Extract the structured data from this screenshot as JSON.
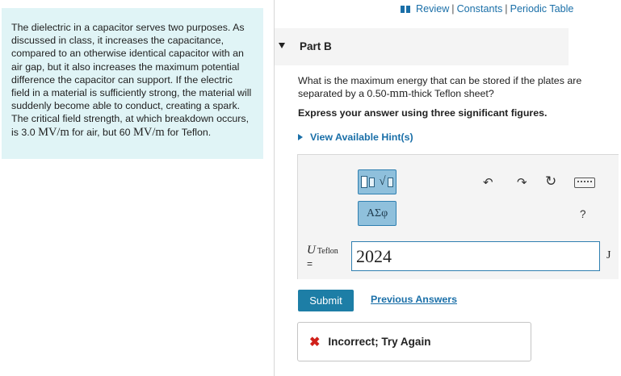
{
  "topbar": {
    "review": "Review",
    "constants": "Constants",
    "periodic": "Periodic Table",
    "sep": "|"
  },
  "intro": {
    "text_before": "The dielectric in a capacitor serves two purposes. As discussed in class, it increases the capacitance, compared to an otherwise identical capacitor with an air gap, but it also  increases the maximum potential difference the capacitor can support. If the electric field in a material is sufficiently strong, the material will suddenly become able to conduct, creating a spark. The critical field strength, at which breakdown occurs, is 3.0 ",
    "unit1": "MV/m",
    "text_mid": " for air, but 60 ",
    "unit2": "MV/m",
    "text_after": " for Teflon."
  },
  "part": {
    "title": "Part B"
  },
  "question": {
    "before": "What is the maximum energy that can be stored if the plates are separated by a 0.50-",
    "unit": "mm",
    "after": "-thick Teflon sheet?"
  },
  "instruction": "Express your answer using three significant figures.",
  "hint_label": "View Available Hint(s)",
  "toolbar": {
    "greek": "ΑΣφ",
    "help": "?",
    "undo": "↶",
    "redo": "↷",
    "reset": "↻"
  },
  "answer": {
    "var": "U",
    "sub": "Teflon",
    "eq": "=",
    "value": "2024",
    "unit": "J"
  },
  "submit_label": "Submit",
  "prev_answers_label": "Previous Answers",
  "feedback": {
    "icon": "✖",
    "message": "Incorrect; Try Again"
  },
  "colors": {
    "accent": "#1a6fa8",
    "panel": "#e0f4f6",
    "submit": "#1d7ea6",
    "error": "#d0201a"
  }
}
